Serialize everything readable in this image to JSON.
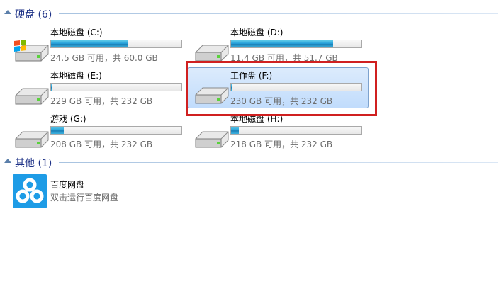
{
  "groups": {
    "hard_disks": {
      "title": "硬盘 (6)"
    },
    "other": {
      "title": "其他 (1)"
    }
  },
  "drives": [
    {
      "name": "本地磁盘 (C:)",
      "space": "24.5 GB 可用，共 60.0 GB",
      "used_fraction": 0.59
    },
    {
      "name": "本地磁盘 (D:)",
      "space": "11.4 GB 可用，共 51.7 GB",
      "used_fraction": 0.78
    },
    {
      "name": "本地磁盘 (E:)",
      "space": "229 GB 可用，共 232 GB",
      "used_fraction": 0.013
    },
    {
      "name": "工作盘 (F:)",
      "space": "230 GB 可用，共 232 GB",
      "used_fraction": 0.009,
      "selected": true
    },
    {
      "name": "游戏 (G:)",
      "space": "208 GB 可用，共 232 GB",
      "used_fraction": 0.1
    },
    {
      "name": "本地磁盘 (H:)",
      "space": "218 GB 可用，共 232 GB",
      "used_fraction": 0.06
    }
  ],
  "other_items": [
    {
      "name": "百度网盘",
      "description": "双击运行百度网盘"
    }
  ],
  "colors": {
    "header_text": "#1e3287",
    "selection": "#c1dcfc",
    "highlight_box": "#d02020",
    "bar_fill": "#26a0da"
  }
}
